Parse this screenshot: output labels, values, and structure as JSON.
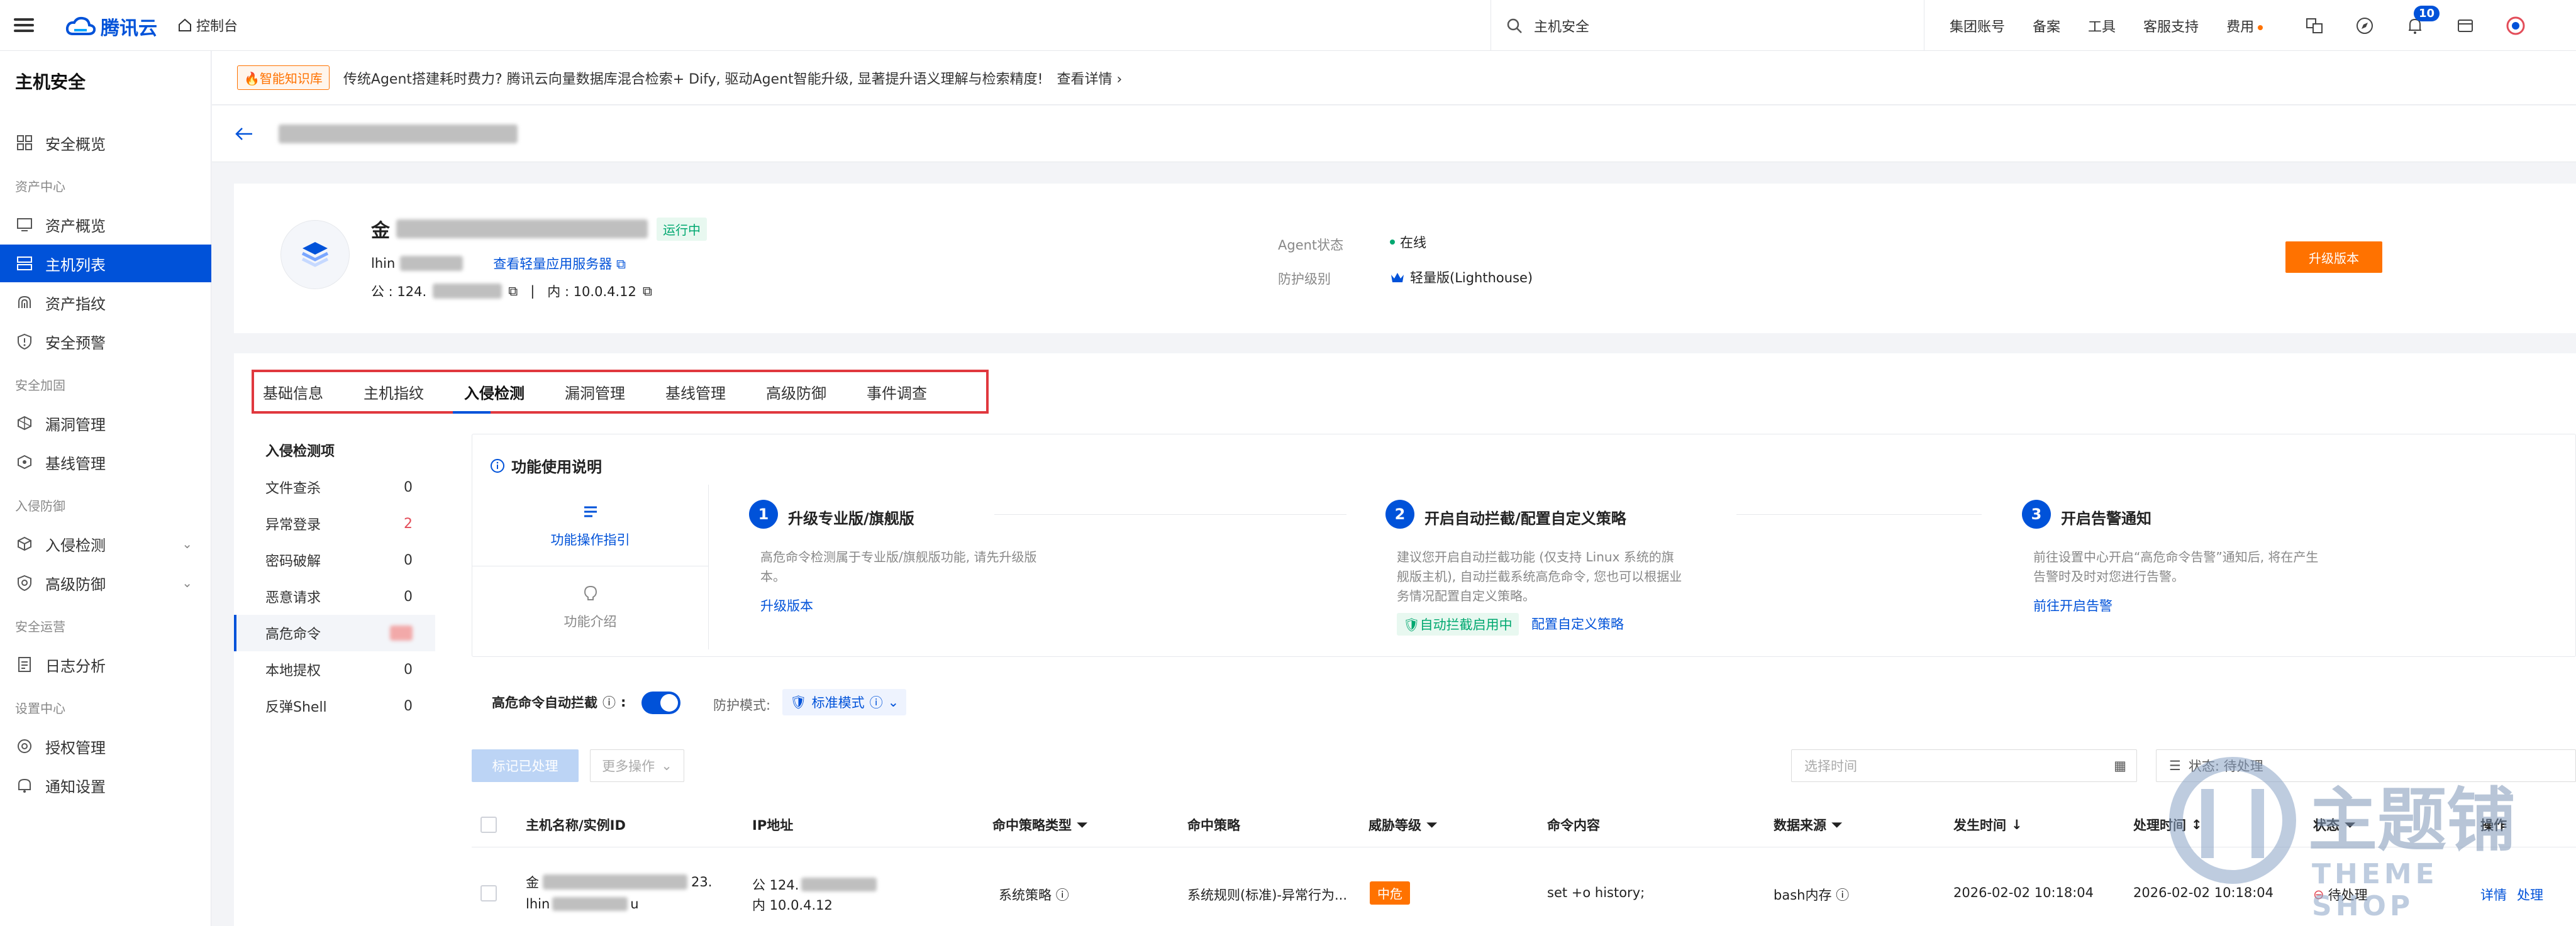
{
  "topbar": {
    "brand": "腾讯云",
    "console": "控制台",
    "search_text": "主机安全",
    "links": [
      "集团账号",
      "备案",
      "工具",
      "客服支持",
      "费用"
    ],
    "notification_count": "10"
  },
  "sidebar": {
    "title": "主机安全",
    "items": [
      {
        "type": "item",
        "label": "安全概览",
        "icon": "grid-icon"
      },
      {
        "type": "group",
        "label": "资产中心"
      },
      {
        "type": "item",
        "label": "资产概览",
        "icon": "monitor-icon"
      },
      {
        "type": "item",
        "label": "主机列表",
        "icon": "server-list-icon",
        "active": true
      },
      {
        "type": "item",
        "label": "资产指纹",
        "icon": "fingerprint-icon"
      },
      {
        "type": "item",
        "label": "安全预警",
        "icon": "shield-alert-icon"
      },
      {
        "type": "group",
        "label": "安全加固"
      },
      {
        "type": "item",
        "label": "漏洞管理",
        "icon": "bug-icon"
      },
      {
        "type": "item",
        "label": "基线管理",
        "icon": "baseline-icon"
      },
      {
        "type": "group",
        "label": "入侵防御"
      },
      {
        "type": "item",
        "label": "入侵检测",
        "icon": "cube-icon",
        "chevron": true
      },
      {
        "type": "item",
        "label": "高级防御",
        "icon": "shield-icon",
        "chevron": true
      },
      {
        "type": "group",
        "label": "安全运营"
      },
      {
        "type": "item",
        "label": "日志分析",
        "icon": "log-icon"
      },
      {
        "type": "group",
        "label": "设置中心"
      },
      {
        "type": "item",
        "label": "授权管理",
        "icon": "license-icon"
      },
      {
        "type": "item",
        "label": "通知设置",
        "icon": "notify-icon"
      }
    ]
  },
  "notice": {
    "tag": "🔥智能知识库",
    "text": "传统Agent搭建耗时费力? 腾讯云向量数据库混合检索+ Dify, 驱动Agent智能升级, 显著提升语义理解与检索精度!",
    "more": "查看详情"
  },
  "host": {
    "name_prefix": "金",
    "status": "运行中",
    "instance_prefix": "lhin",
    "view_link": "查看轻量应用服务器",
    "public_ip_label": "公 : 124.",
    "private_ip_label": "内 : 10.0.4.12",
    "agent_label": "Agent状态",
    "agent_value": "在线",
    "protect_label": "防护级别",
    "protect_value": "轻量版(Lighthouse)",
    "upgrade_button": "升级版本"
  },
  "tabs": [
    "基础信息",
    "主机指纹",
    "入侵检测",
    "漏洞管理",
    "基线管理",
    "高级防御",
    "事件调查"
  ],
  "active_tab": "入侵检测",
  "detect_nav": {
    "title": "入侵检测项",
    "items": [
      {
        "label": "文件查杀",
        "count": "0"
      },
      {
        "label": "异常登录",
        "count": "2",
        "alert": true
      },
      {
        "label": "密码破解",
        "count": "0"
      },
      {
        "label": "恶意请求",
        "count": "0"
      },
      {
        "label": "高危命令",
        "count": "",
        "active": true
      },
      {
        "label": "本地提权",
        "count": "0"
      },
      {
        "label": "反弹Shell",
        "count": "0"
      }
    ]
  },
  "feature": {
    "title": "功能使用说明",
    "guide": "功能操作指引",
    "intro": "功能介绍",
    "steps": [
      {
        "num": "1",
        "title": "升级专业版/旗舰版",
        "desc": "高危命令检测属于专业版/旗舰版功能, 请先升级版本。",
        "link": "升级版本"
      },
      {
        "num": "2",
        "title": "开启自动拦截/配置自定义策略",
        "desc": "建议您开启自动拦截功能 (仅支持 Linux 系统的旗舰版主机), 自动拦截系统高危命令, 您也可以根据业务情况配置自定义策略。",
        "tag": "自动拦截启用中",
        "link": "配置自定义策略"
      },
      {
        "num": "3",
        "title": "开启告警通知",
        "desc": "前往设置中心开启“高危命令告警”通知后, 将在产生告警时及时对您进行告警。",
        "link": "前往开启告警"
      }
    ]
  },
  "controls": {
    "auto_block_label": "高危命令自动拦截",
    "mode_label": "防护模式:",
    "mode_value": "标准模式",
    "mark_button": "标记已处理",
    "more_button": "更多操作",
    "time_placeholder": "选择时间",
    "status_filter": "状态: 待处理"
  },
  "table": {
    "headers": [
      "主机名称/实例ID",
      "IP地址",
      "命中策略类型",
      "命中策略",
      "威胁等级",
      "命令内容",
      "数据来源",
      "发生时间",
      "处理时间",
      "状态",
      "操作"
    ],
    "rows": [
      {
        "host_prefix": "金",
        "host_suffix": "23.",
        "instance_prefix": "lhin",
        "instance_suffix": "u",
        "public_ip": "公 124.",
        "private_ip": "内 10.0.4.12",
        "policy_type": "系统策略",
        "policy": "系统规则(标准)-异常行为...",
        "level": "中危",
        "command": "set +o history;",
        "source": "bash内存",
        "occur_time": "2026-02-02 10:18:04",
        "handle_time": "2026-02-02 10:18:04",
        "status": "待处理",
        "actions": [
          "详情",
          "处理"
        ]
      }
    ]
  },
  "watermark": {
    "text_cn": "主题铺",
    "text_en": "THEME SHOP"
  },
  "colors": {
    "accent": "#0052d9",
    "warning": "#ff7200",
    "success": "#00a870",
    "danger": "#e34d59"
  }
}
